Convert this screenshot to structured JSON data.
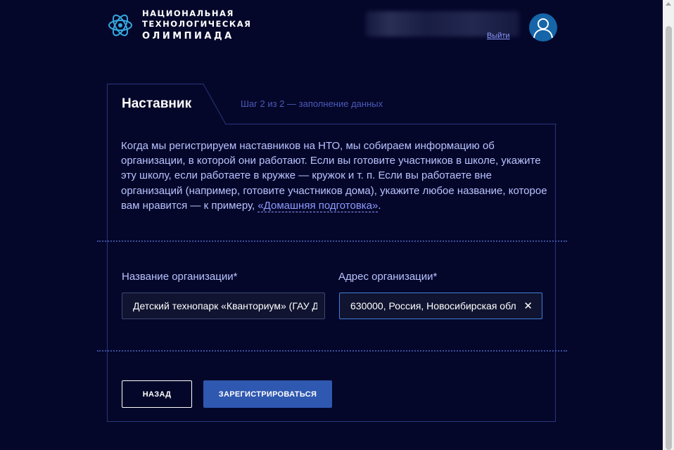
{
  "header": {
    "logo_line1": "НАЦИОНАЛЬНАЯ",
    "logo_line2": "ТЕХНОЛОГИЧЕСКАЯ",
    "logo_line3": "ОЛИМПИАДА",
    "logout_label": "Выйти"
  },
  "form": {
    "tab_title": "Наставник",
    "step_text": "Шаг 2 из 2 — заполнение данных",
    "description_text": "Когда мы регистрируем наставников на НТО, мы собираем информацию об организации, в которой они работают. Если вы готовите участников в школе, укажите эту школу, если работаете в кружке — кружок и т. п. Если вы работаете вне организаций (например, готовите участников дома), укажите любое название, которое вам нравится — к примеру, ",
    "description_link": "«Домашняя подготовка»",
    "description_end": ".",
    "org_name_label": "Название организации*",
    "org_name_value": "Детский технопарк «Кванториум» (ГАУ Д",
    "org_address_label": "Адрес организации*",
    "org_address_value": "630000, Россия, Новосибирская обл",
    "back_button": "НАЗАД",
    "register_button": "ЗАРЕГИСТРИРОВАТЬСЯ"
  },
  "colors": {
    "background": "#05072a",
    "accent": "#2f58b0",
    "text": "#b8c3ff",
    "link": "#8d9bff"
  },
  "icons": {
    "logo": "nto-logo-icon",
    "avatar": "user-avatar-icon",
    "clear": "close-icon"
  }
}
